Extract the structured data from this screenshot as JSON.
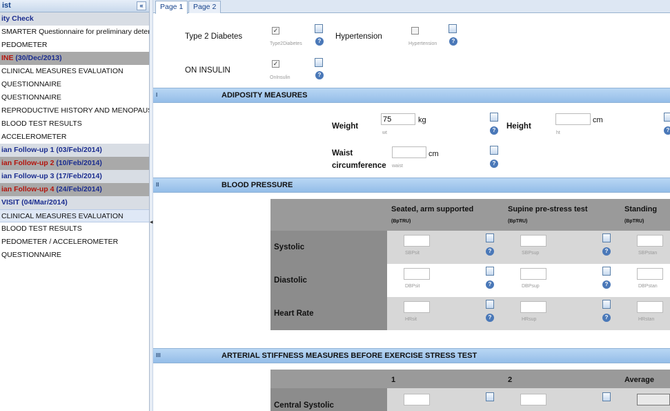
{
  "sidebar": {
    "header": "ist",
    "collapse_glyph": "«",
    "items": [
      {
        "label": "ity Check",
        "style": "grp"
      },
      {
        "label": "SMARTER Questionnaire for preliminary deter",
        "style": "item"
      },
      {
        "label": "PEDOMETER",
        "style": "item"
      },
      {
        "label": "INE (30/Dec/2013)",
        "label_red": "INE",
        "label_blue": " (30/Dec/2013)",
        "style": "grp-dark"
      },
      {
        "label": "CLINICAL MEASURES EVALUATION",
        "style": "item"
      },
      {
        "label": "QUESTIONNAIRE",
        "style": "item"
      },
      {
        "label": "QUESTIONNAIRE",
        "style": "item"
      },
      {
        "label": "REPRODUCTIVE HISTORY AND MENOPAUSE",
        "style": "item"
      },
      {
        "label": "BLOOD TEST RESULTS",
        "style": "item"
      },
      {
        "label": "ACCELEROMETER",
        "style": "item"
      },
      {
        "label": "ian Follow-up 1 (03/Feb/2014)",
        "style": "grp"
      },
      {
        "label": "ian Follow-up 2 (10/Feb/2014)",
        "label_red": "ian Follow-up 2",
        "label_blue": " (10/Feb/2014)",
        "style": "grp-dark"
      },
      {
        "label": "ian Follow-up 3 (17/Feb/2014)",
        "style": "grp"
      },
      {
        "label": "ian Follow-up 4 (24/Feb/2014)",
        "label_red": "ian Follow-up 4",
        "label_blue": " (24/Feb/2014)",
        "style": "grp-dark"
      },
      {
        "label": "VISIT (04/Mar/2014)",
        "style": "grp"
      },
      {
        "label": "CLINICAL MEASURES EVALUATION",
        "style": "sel"
      },
      {
        "label": "BLOOD TEST RESULTS",
        "style": "item"
      },
      {
        "label": "PEDOMETER / ACCELEROMETER",
        "style": "item"
      },
      {
        "label": "QUESTIONNAIRE",
        "style": "item"
      }
    ]
  },
  "splitter_glyph": "◂",
  "tabs": [
    {
      "label": "Page 1",
      "active": true
    },
    {
      "label": "Page 2",
      "active": false
    }
  ],
  "conditions": {
    "type2": {
      "label": "Type 2 Diabetes",
      "checked": true,
      "var": "Type2Diabetes"
    },
    "hypertension": {
      "label": "Hypertension",
      "checked": false,
      "var": "Hypertension"
    },
    "insulin": {
      "label": "ON INSULIN",
      "checked": true,
      "var": "OnInsulin"
    }
  },
  "adiposity": {
    "roman": "I",
    "title": "ADIPOSITY MEASURES",
    "weight": {
      "label": "Weight",
      "value": "75",
      "unit": "kg",
      "var": "wt"
    },
    "height": {
      "label": "Height",
      "value": "",
      "unit": "cm",
      "var": "ht"
    },
    "waist": {
      "label1": "Waist",
      "label2": "circumference",
      "value": "",
      "unit": "cm",
      "var": "waist"
    }
  },
  "bp": {
    "roman": "II",
    "title": "BLOOD PRESSURE",
    "columns": [
      {
        "label": "Seated, arm supported",
        "code": "(BpTRU)"
      },
      {
        "label": "Supine pre-stress test",
        "code": "(BpTRU)"
      },
      {
        "label": "Standing",
        "code": "(BpTRU)"
      }
    ],
    "rows": [
      {
        "label": "Systolic",
        "vars": [
          "SBPsit",
          "SBPsup",
          "SBPstan"
        ]
      },
      {
        "label": "Diastolic",
        "vars": [
          "DBPsit",
          "DBPsup",
          "DBPstan"
        ]
      },
      {
        "label": "Heart Rate",
        "vars": [
          "HRsit",
          "HRsup",
          "HRstan"
        ]
      }
    ]
  },
  "arterial": {
    "roman": "III",
    "title": "ARTERIAL STIFFNESS MEASURES BEFORE EXERCISE STRESS TEST",
    "columns": [
      "1",
      "2",
      "Average"
    ],
    "rows": [
      {
        "label": "Central Systolic"
      }
    ]
  },
  "icons": {
    "check": "✓",
    "help": "?"
  }
}
